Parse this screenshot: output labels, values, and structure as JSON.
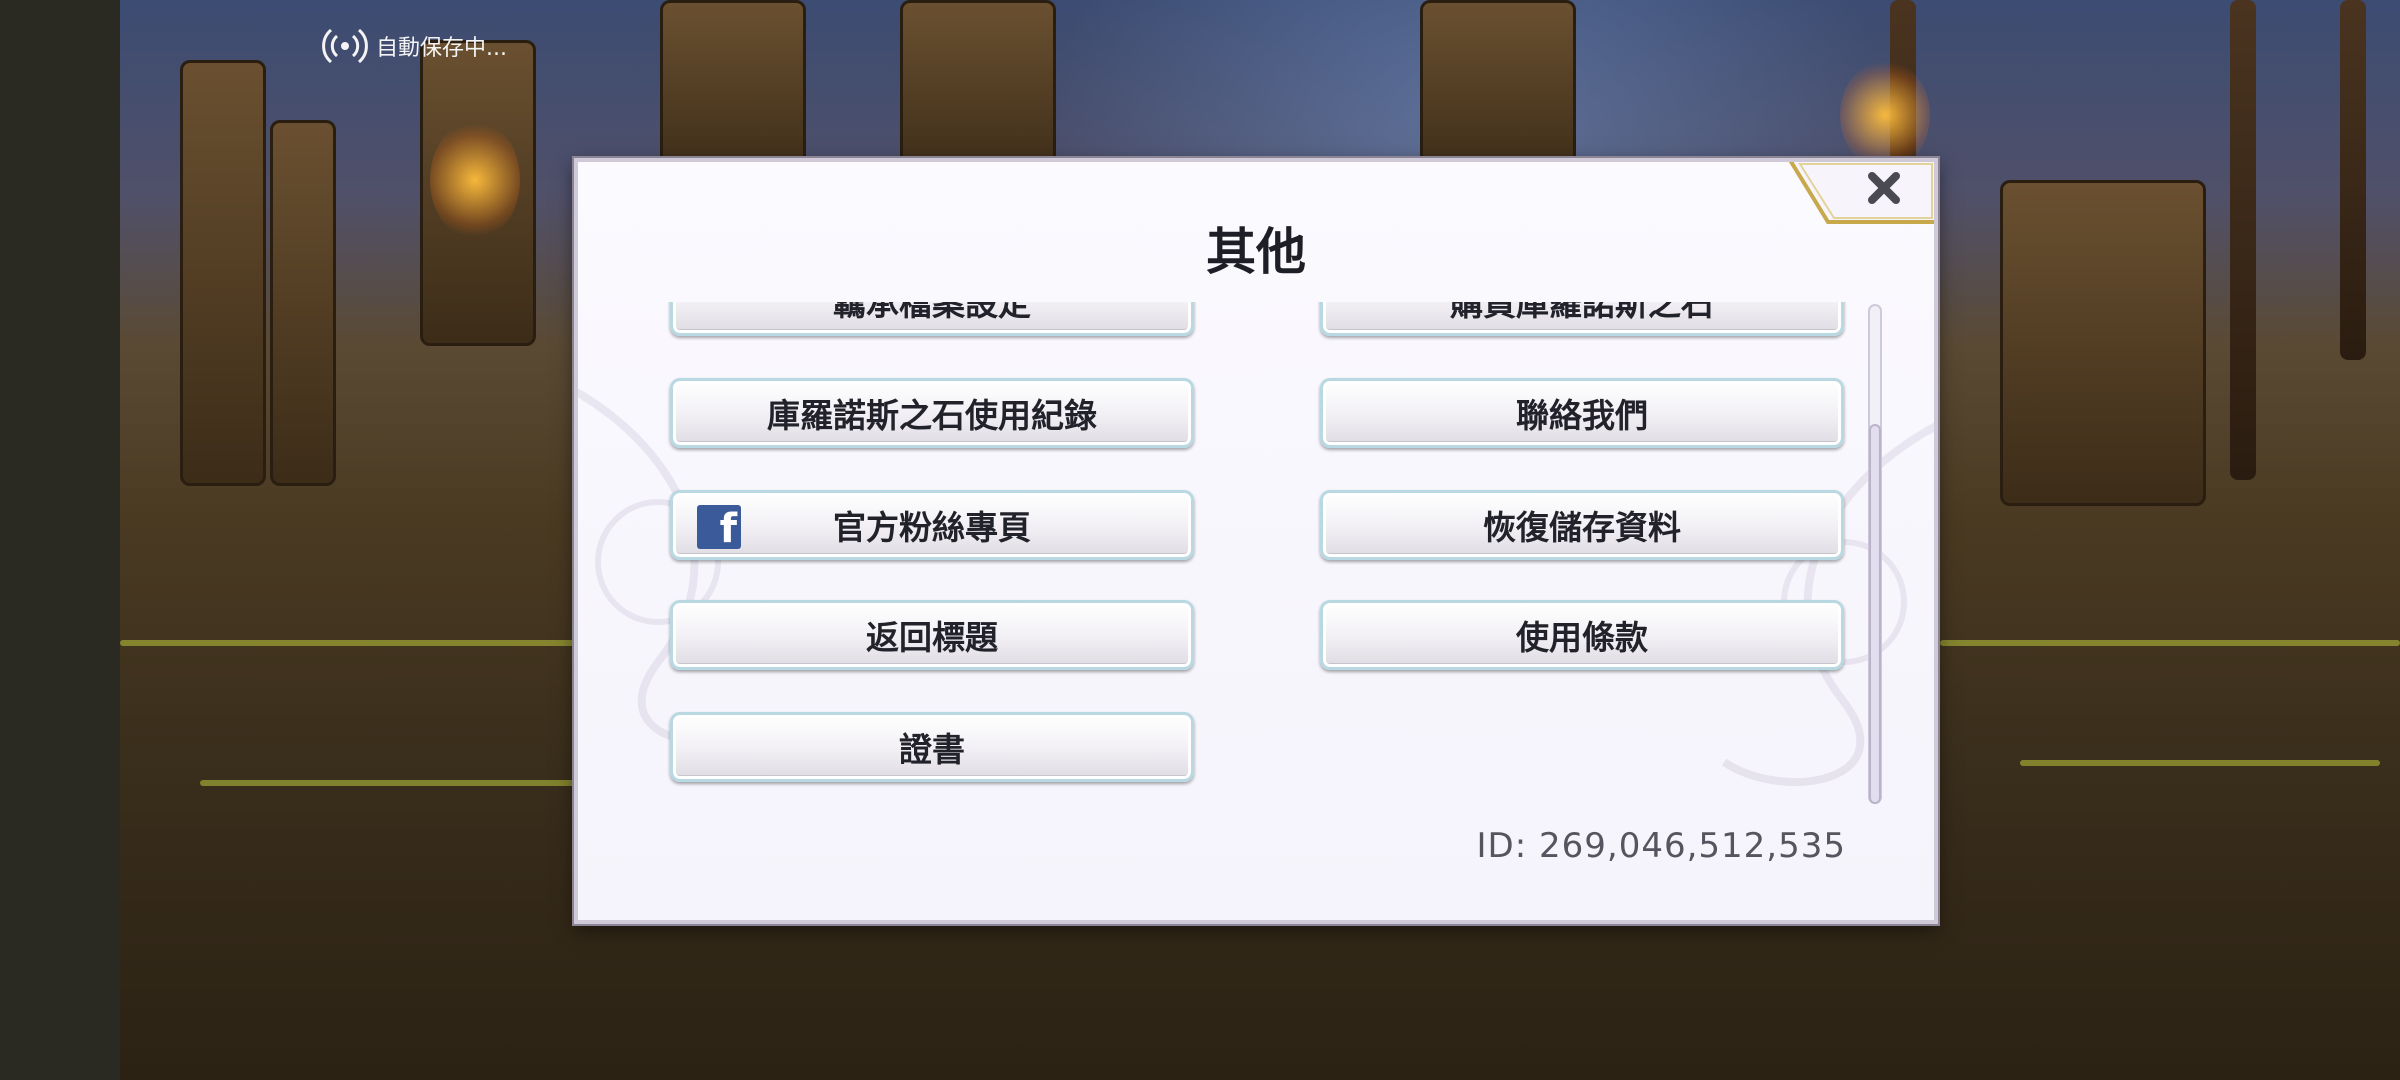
{
  "status": {
    "autosave_text": "自動保存中..."
  },
  "dialog": {
    "title": "其他",
    "close_icon": "close-x-icon",
    "buttons": [
      {
        "id": "archive-settings",
        "label": "羈承檔案設定"
      },
      {
        "id": "buy-stones",
        "label": "購買庫羅諾斯之石"
      },
      {
        "id": "stone-history",
        "label": "庫羅諾斯之石使用紀錄"
      },
      {
        "id": "contact-us",
        "label": "聯絡我們"
      },
      {
        "id": "fan-page",
        "label": "官方粉絲專頁",
        "icon": "facebook-icon"
      },
      {
        "id": "restore-save",
        "label": "恢復儲存資料"
      },
      {
        "id": "return-title",
        "label": "返回標題"
      },
      {
        "id": "terms",
        "label": "使用條款"
      },
      {
        "id": "license",
        "label": "證書"
      }
    ],
    "id_text": "ID: 269,046,512,535",
    "scroll_position": 0.35
  }
}
